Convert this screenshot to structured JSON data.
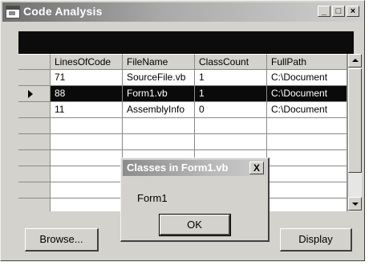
{
  "window": {
    "title": "Code Analysis",
    "min_glyph": "_",
    "max_glyph": "□",
    "close_glyph": "×"
  },
  "grid": {
    "columns": [
      "LinesOfCode",
      "FileName",
      "ClassCount",
      "FullPath"
    ],
    "rows": [
      [
        "71",
        "SourceFile.vb",
        "1",
        "C:\\Document"
      ],
      [
        "88",
        "Form1.vb",
        "1",
        "C:\\Document"
      ],
      [
        "11",
        "AssemblyInfo",
        "0",
        "C:\\Document"
      ]
    ],
    "selected_row": 1
  },
  "buttons": {
    "browse": "Browse...",
    "display": "Display"
  },
  "dialog": {
    "title": "Classes in Form1.vb",
    "close_glyph": "X",
    "message": "Form1",
    "ok": "OK"
  }
}
